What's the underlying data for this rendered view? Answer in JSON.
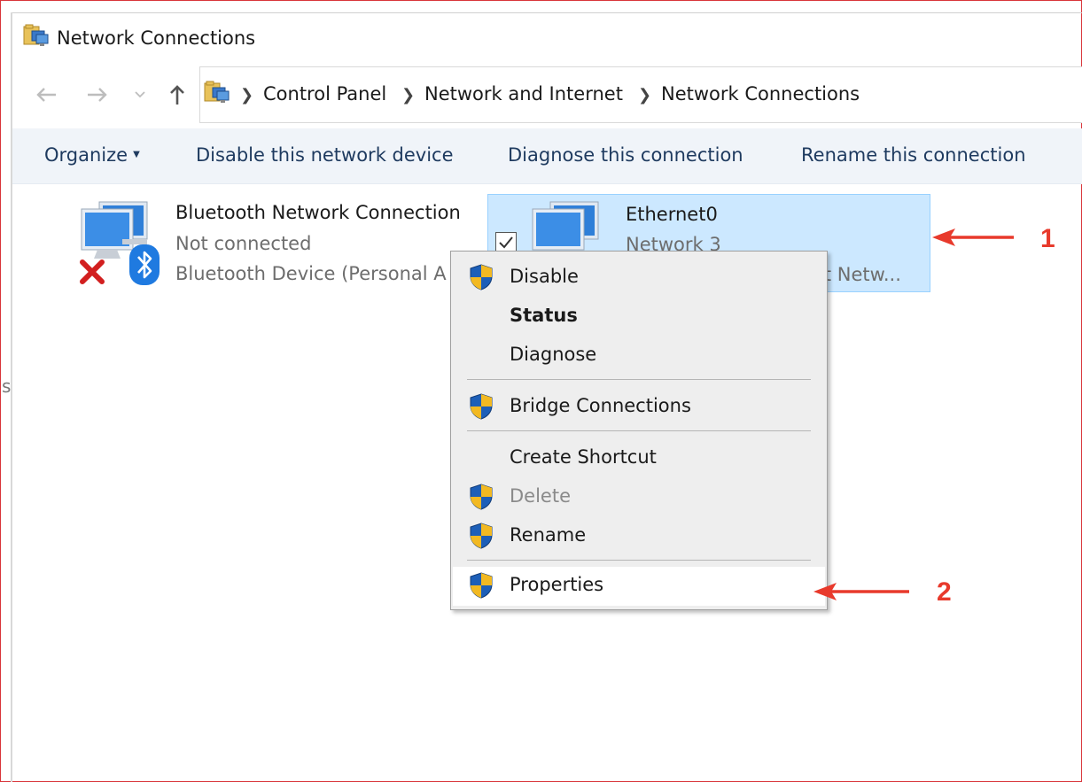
{
  "window": {
    "title": "Network Connections"
  },
  "address": {
    "crumbs": [
      "Control Panel",
      "Network and Internet",
      "Network Connections"
    ]
  },
  "toolbar": {
    "organize": "Organize",
    "disable": "Disable this network device",
    "diagnose": "Diagnose this connection",
    "rename": "Rename this connection"
  },
  "connections": [
    {
      "name": "Bluetooth Network Connection",
      "status": "Not connected",
      "device": "Bluetooth Device (Personal A"
    },
    {
      "name": "Ethernet0",
      "status": "Network  3",
      "device": "it Netw..."
    }
  ],
  "context_menu": {
    "items": [
      {
        "label": "Disable",
        "shield": true
      },
      {
        "label": "Status",
        "shield": false,
        "bold": true
      },
      {
        "label": "Diagnose",
        "shield": false
      },
      {
        "label": "Bridge Connections",
        "shield": true
      },
      {
        "label": "Create Shortcut",
        "shield": false
      },
      {
        "label": "Delete",
        "shield": true,
        "disabled": true
      },
      {
        "label": "Rename",
        "shield": true
      },
      {
        "label": "Properties",
        "shield": true,
        "highlighted": true
      }
    ]
  },
  "annotations": {
    "step1": "1",
    "step2": "2",
    "color": "#e83a2c"
  },
  "stray_text": "s",
  "colors": {
    "selection": "#cce8ff",
    "command_bar": "#f0f4f9",
    "menu_bg": "#eeeeee"
  }
}
